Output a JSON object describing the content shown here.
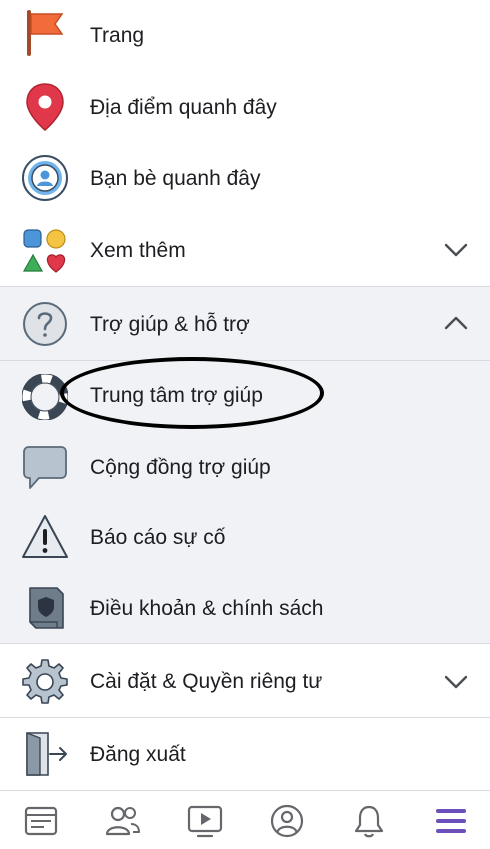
{
  "menu": {
    "pages": "Trang",
    "nearby_places": "Địa điểm quanh đây",
    "nearby_friends": "Bạn bè quanh đây",
    "see_more": "Xem thêm",
    "help_support": "Trợ giúp & hỗ trợ",
    "help_center": "Trung tâm trợ giúp",
    "help_community": "Cộng đồng trợ giúp",
    "report_problem": "Báo cáo sự cố",
    "terms_policies": "Điều khoản & chính sách",
    "settings_privacy": "Cài đặt & Quyền riêng tư",
    "log_out": "Đăng xuất"
  },
  "tabs": [
    "news-feed-icon",
    "friends-icon",
    "watch-icon",
    "profile-icon",
    "notifications-icon",
    "menu-icon"
  ],
  "colors": {
    "accent_menu": "#6b4fbb",
    "icon_gray": "#5b6a79",
    "flag_orange": "#f26b3a",
    "pin_red": "#e0374a",
    "friends_blue": "#4b96d8",
    "section_bg": "#f0f2f5"
  }
}
